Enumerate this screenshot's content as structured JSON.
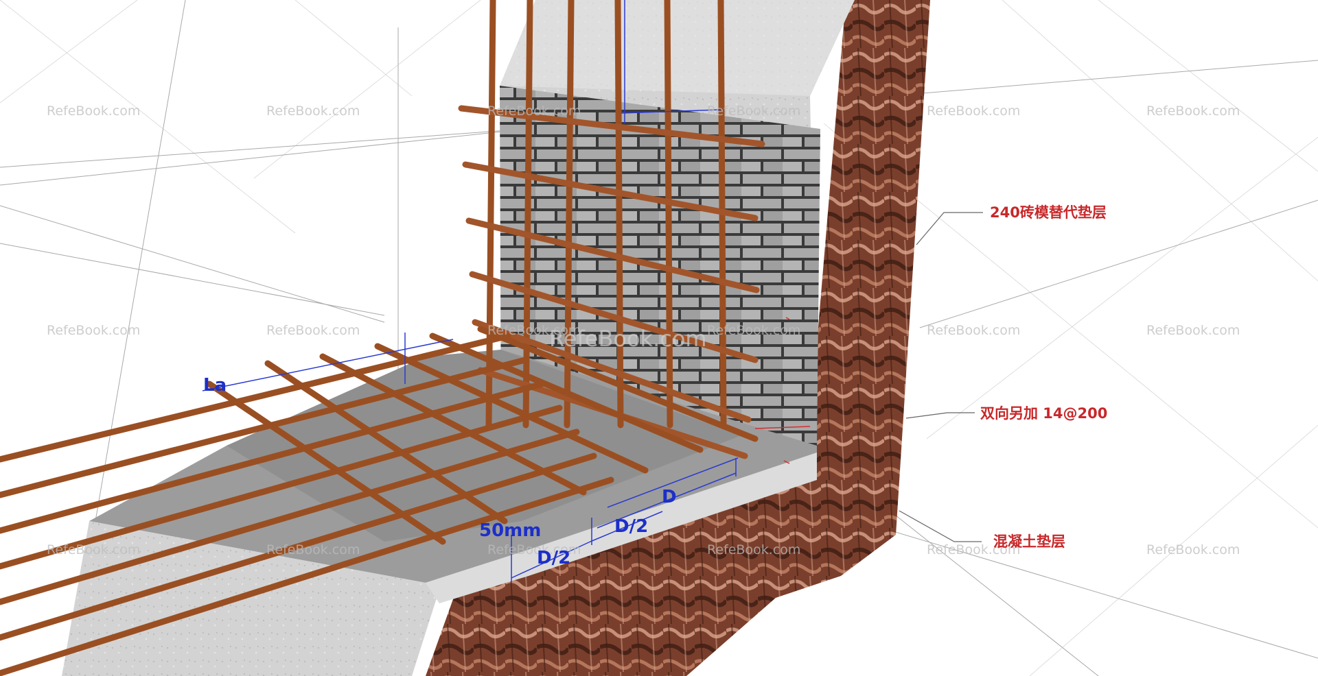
{
  "labels": {
    "brick_mold": "240砖模替代垫层",
    "extra_bars": "双向另加 14@200",
    "concrete_bed": "混凝土垫层"
  },
  "dimensions": {
    "la": "La",
    "fifty_mm": "50mm",
    "d": "D",
    "d_half_a": "D/2",
    "d_half_b": "D/2"
  },
  "watermark": {
    "text": "RefeBook.com",
    "center_text": "RefeBook.com"
  },
  "colors": {
    "label_red": "#c8282a",
    "dim_blue": "#1c2fc8",
    "rebar": "#9a4f22",
    "concrete": "#cfcfcf",
    "bark": "#7a3f2c"
  }
}
